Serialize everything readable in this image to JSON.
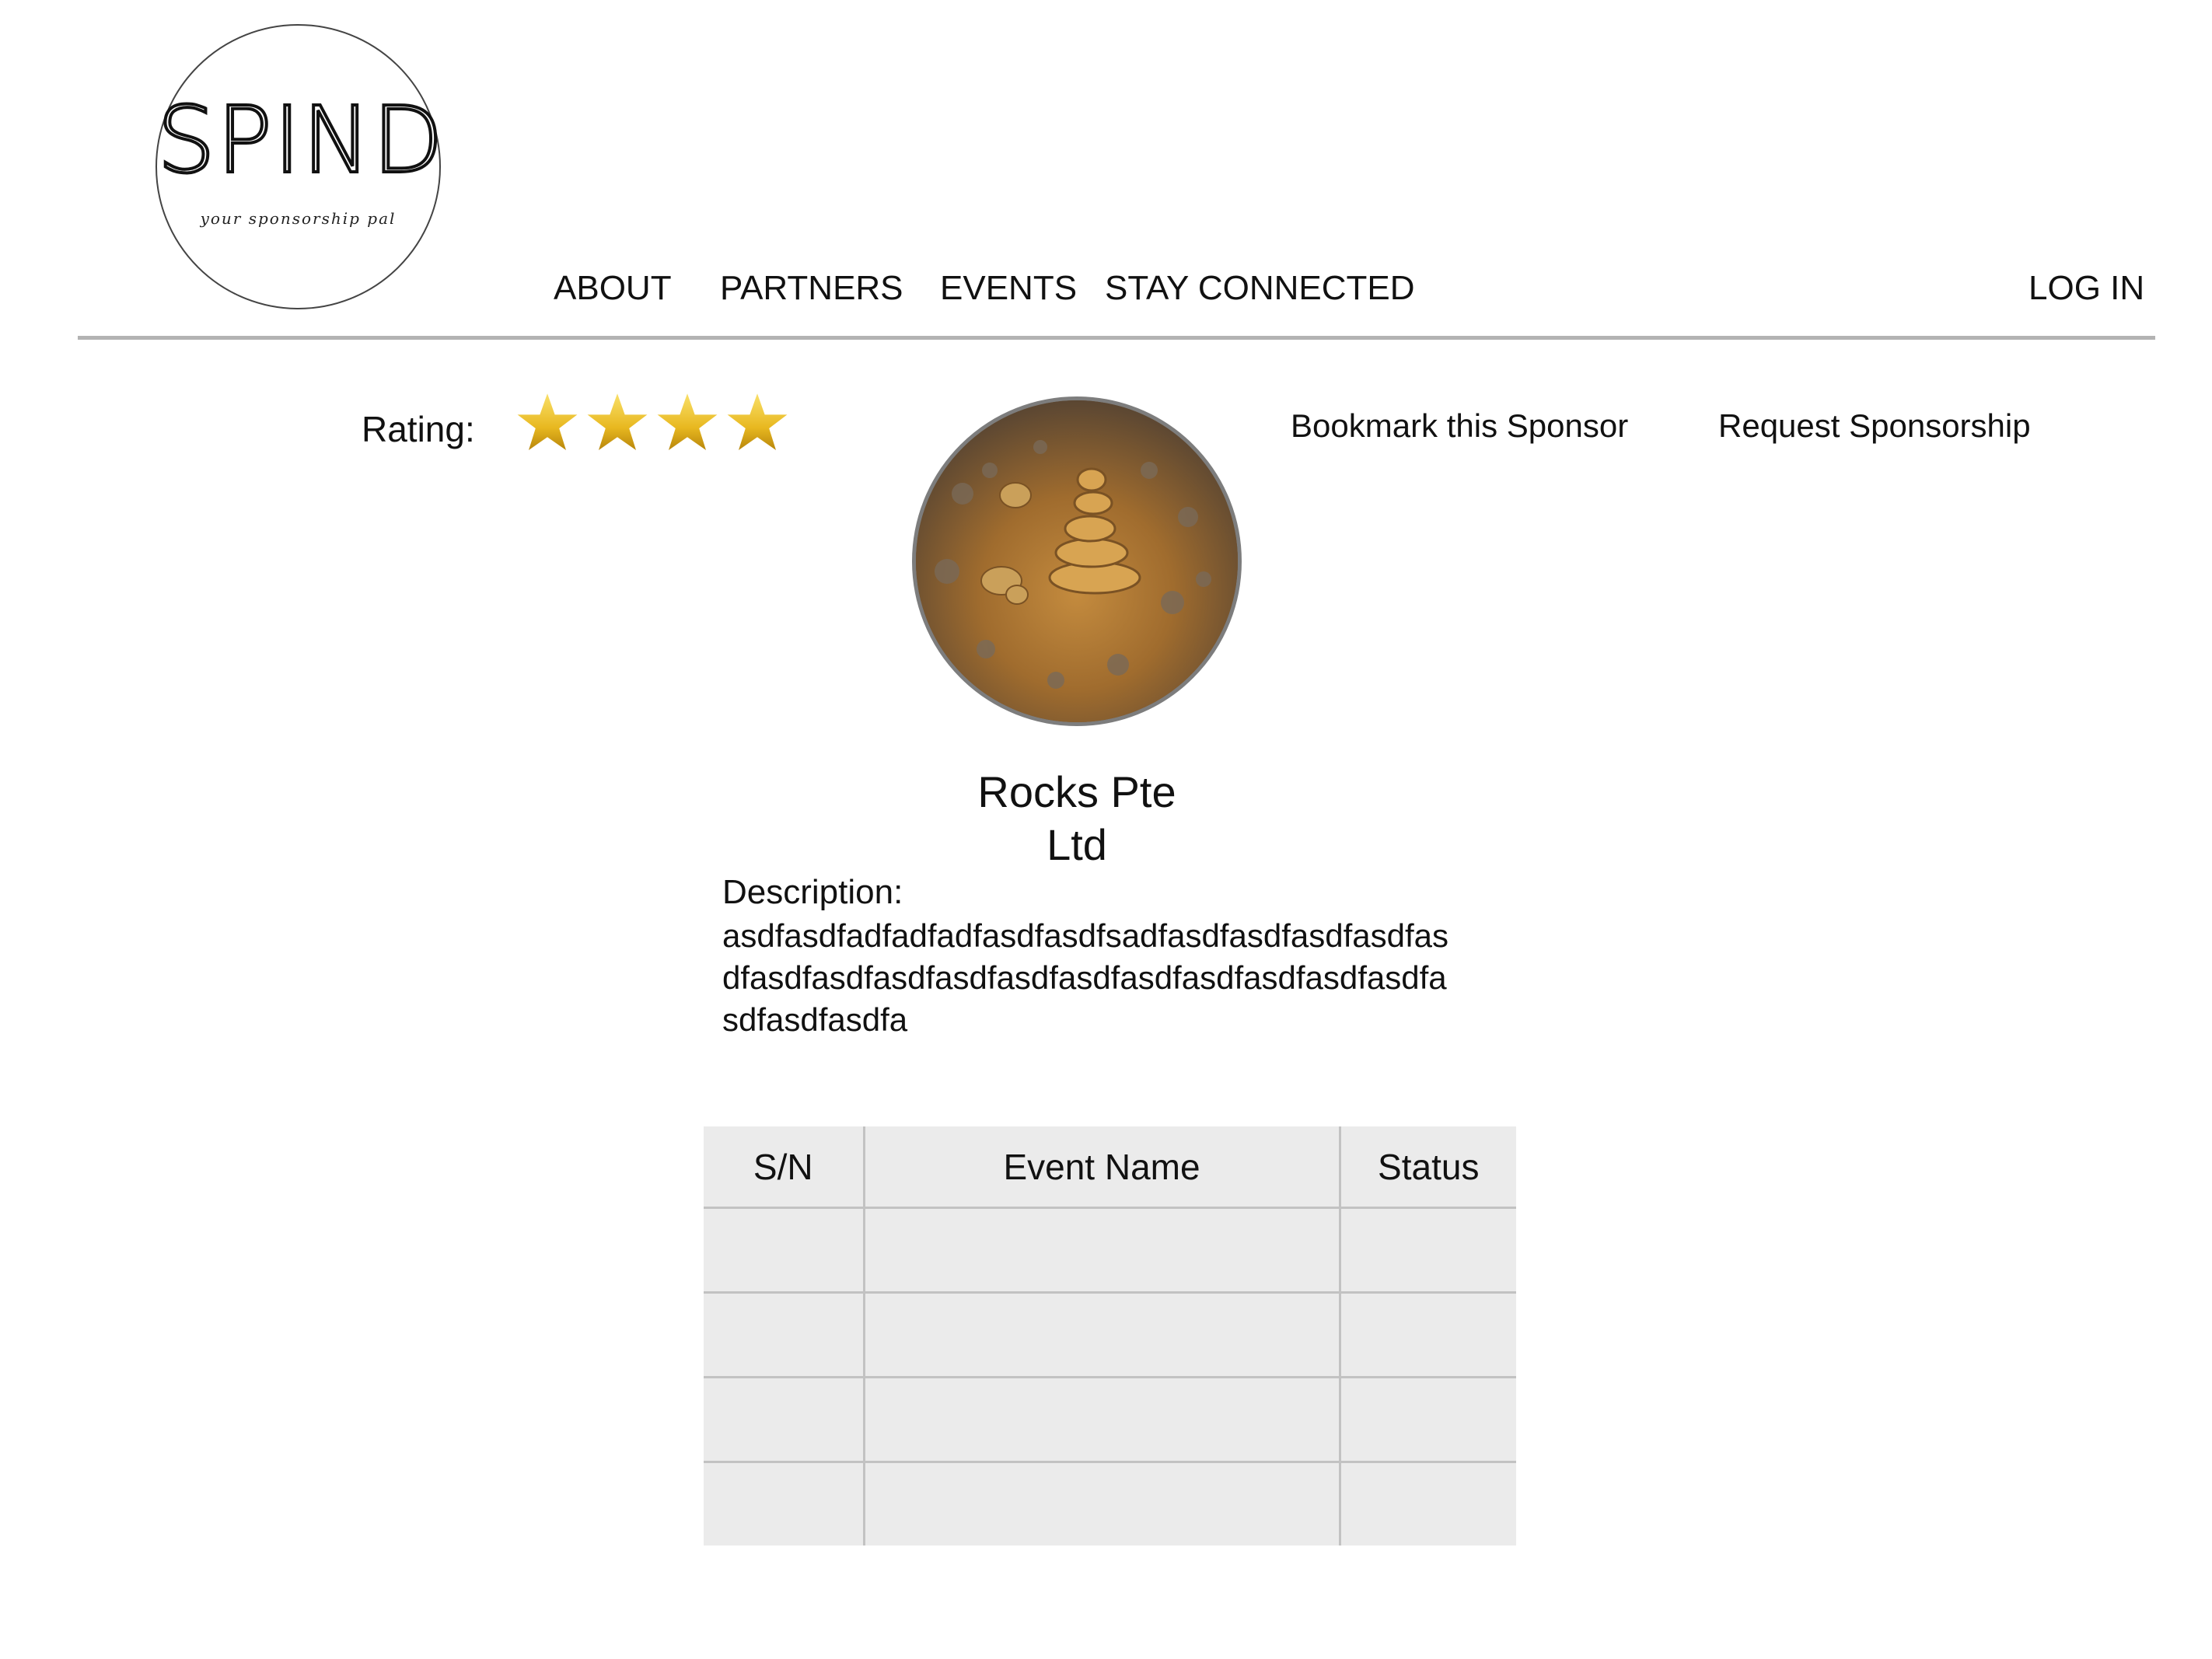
{
  "logo": {
    "wordmark": "SPIND",
    "tagline": "your sponsorship pal"
  },
  "nav": {
    "items": [
      {
        "label": "ABOUT"
      },
      {
        "label": "PARTNERS"
      },
      {
        "label": "EVENTS"
      },
      {
        "label": "STAY CONNECTED"
      }
    ],
    "login_label": "LOG IN"
  },
  "sponsor": {
    "rating_label": "Rating:",
    "rating_value": 4,
    "bookmark_label": "Bookmark this Sponsor",
    "request_label": "Request Sponsorship",
    "name_line1": "Rocks Pte",
    "name_line2": "Ltd",
    "description_label": "Description:",
    "description_text": "asdfasdfadfadfadfasdfasdfsadfasdfasdfasdfasdfasdfasdfasdfasdfasdfasdfasdfasdfasdfasdfasdfasdfasdfasdfasdfa"
  },
  "events_table": {
    "headers": [
      "S/N",
      "Event Name",
      "Status"
    ],
    "rows": [
      [
        "",
        "",
        ""
      ],
      [
        "",
        "",
        ""
      ],
      [
        "",
        "",
        ""
      ],
      [
        "",
        "",
        ""
      ]
    ]
  },
  "icons": {
    "star": "star-icon",
    "avatar_image": "rock-cairn-photo"
  },
  "colors": {
    "star_gold": "#e8b820",
    "table_bg": "#ebebeb",
    "rule": "#b3b3b3"
  }
}
